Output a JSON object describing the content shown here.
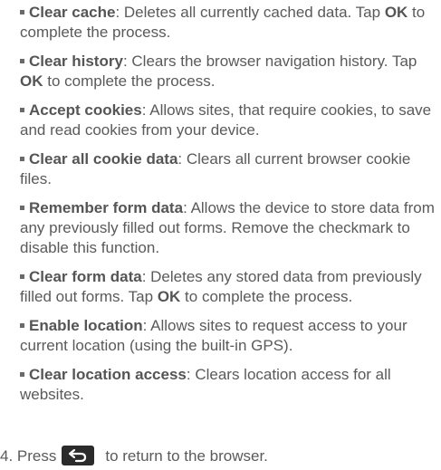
{
  "items": [
    {
      "term": "Clear cache",
      "desc": ": Deletes all currently cached data. Tap ",
      "ok": "OK",
      "desc2": " to complete the process."
    },
    {
      "term": "Clear history",
      "desc": ": Clears the browser navigation history. Tap ",
      "ok": "OK",
      "desc2": " to complete the process."
    },
    {
      "term": "Accept cookies",
      "desc": ": Allows sites, that require cookies, to save and read cookies from your device.",
      "ok": "",
      "desc2": ""
    },
    {
      "term": "Clear all cookie data",
      "desc": ": Clears all current browser cookie files.",
      "ok": "",
      "desc2": ""
    },
    {
      "term": "Remember form data",
      "desc": ": Allows the device to store data from any previously filled out forms. Remove the checkmark to disable this function.",
      "ok": "",
      "desc2": ""
    },
    {
      "term": "Clear form data",
      "desc": ": Deletes any stored data from previously filled out forms. Tap ",
      "ok": "OK",
      "desc2": " to complete the process."
    },
    {
      "term": "Enable location",
      "desc": ": Allows sites to request access to your current location (using the built-in GPS).",
      "ok": "",
      "desc2": ""
    },
    {
      "term": "Clear location access",
      "desc": ": Clears location access for all websites.",
      "ok": "",
      "desc2": ""
    }
  ],
  "step": {
    "prefix": "4. Press",
    "icon": "back-arrow-icon",
    "suffix": "to return to the browser."
  }
}
